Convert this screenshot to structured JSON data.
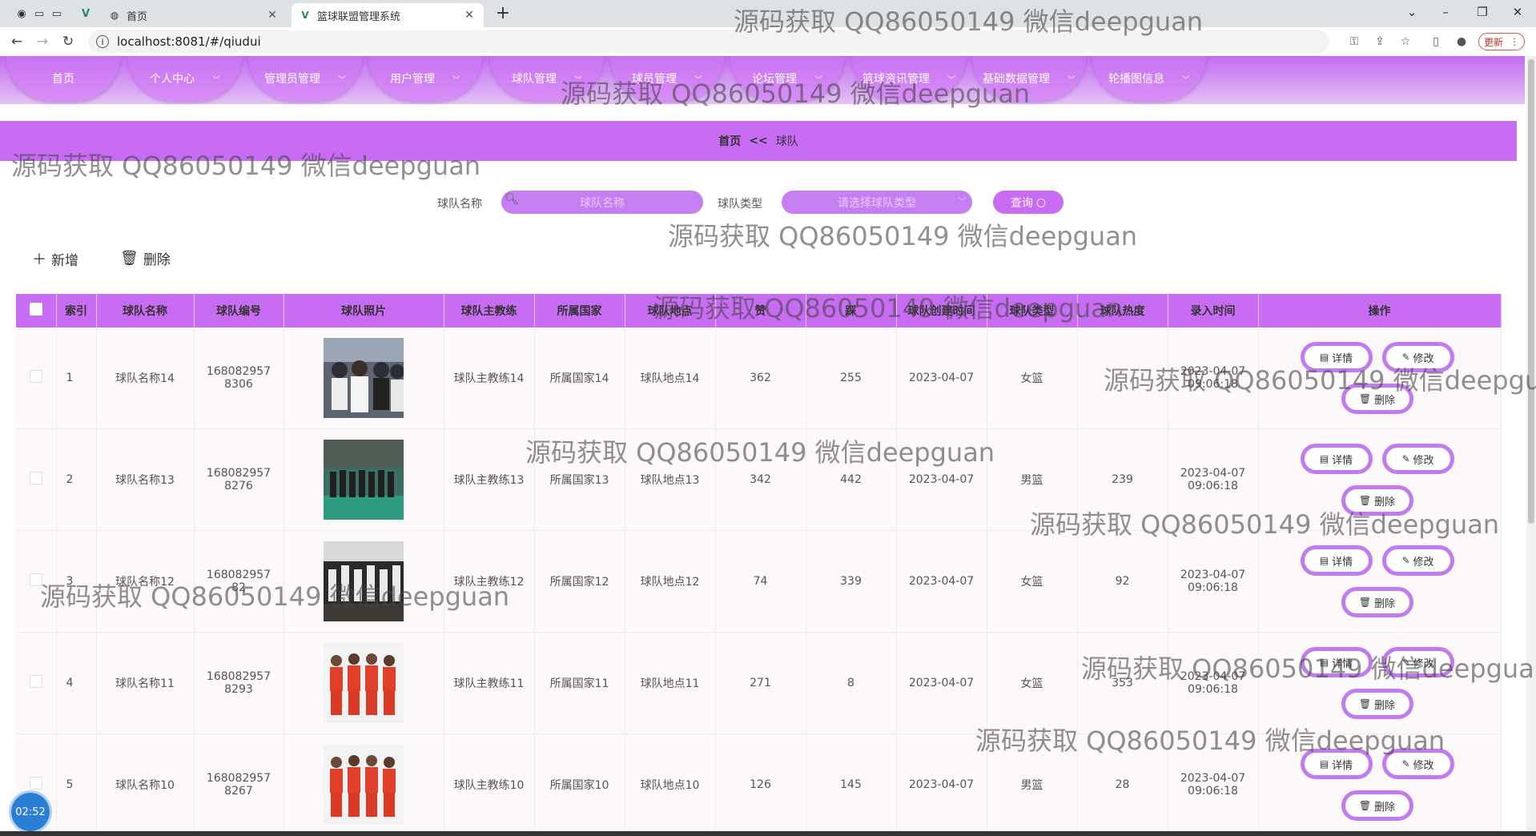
{
  "browser": {
    "tabs": [
      {
        "title": "首页",
        "icon": "globe-icon"
      },
      {
        "title": "篮球联盟管理系统",
        "icon": "vue-logo-icon"
      }
    ],
    "url": "localhost:8081/#/qiudui",
    "update_label": "更新"
  },
  "nav": {
    "items": [
      {
        "label": "首页",
        "dropdown": false
      },
      {
        "label": "个人中心",
        "dropdown": true
      },
      {
        "label": "管理员管理",
        "dropdown": true
      },
      {
        "label": "用户管理",
        "dropdown": true
      },
      {
        "label": "球队管理",
        "dropdown": true
      },
      {
        "label": "球员管理",
        "dropdown": true
      },
      {
        "label": "论坛管理",
        "dropdown": true
      },
      {
        "label": "篮球资讯管理",
        "dropdown": true
      },
      {
        "label": "基础数据管理",
        "dropdown": true
      },
      {
        "label": "轮播图信息",
        "dropdown": true
      }
    ]
  },
  "breadcrumb": {
    "home": "首页",
    "sep": "<<",
    "current": "球队"
  },
  "search": {
    "name_label": "球队名称",
    "name_placeholder": "球队名称",
    "type_label": "球队类型",
    "type_placeholder": "请选择球队类型",
    "query_label": "查询"
  },
  "actions": {
    "add_label": "新增",
    "delete_label": "删除"
  },
  "table": {
    "headers": [
      "索引",
      "球队名称",
      "球队编号",
      "球队照片",
      "球队主教练",
      "所属国家",
      "球队地点",
      "赞",
      "踩",
      "球队创建时间",
      "球队类型",
      "球队热度",
      "录入时间",
      "操作"
    ],
    "rows": [
      {
        "index": "1",
        "name": "球队名称14",
        "code": "1680829578306",
        "coach": "球队主教练14",
        "country": "所属国家14",
        "place": "球队地点14",
        "likes": "362",
        "dislikes": "255",
        "created": "2023-04-07",
        "type": "女篮",
        "heat": "",
        "entered": "2023-04-07 09:06:18"
      },
      {
        "index": "2",
        "name": "球队名称13",
        "code": "1680829578276",
        "coach": "球队主教练13",
        "country": "所属国家13",
        "place": "球队地点13",
        "likes": "342",
        "dislikes": "442",
        "created": "2023-04-07",
        "type": "男篮",
        "heat": "239",
        "entered": "2023-04-07 09:06:18"
      },
      {
        "index": "3",
        "name": "球队名称12",
        "code": "16808295782",
        "coach": "球队主教练12",
        "country": "所属国家12",
        "place": "球队地点12",
        "likes": "74",
        "dislikes": "339",
        "created": "2023-04-07",
        "type": "女篮",
        "heat": "92",
        "entered": "2023-04-07 09:06:18"
      },
      {
        "index": "4",
        "name": "球队名称11",
        "code": "1680829578293",
        "coach": "球队主教练11",
        "country": "所属国家11",
        "place": "球队地点11",
        "likes": "271",
        "dislikes": "8",
        "created": "2023-04-07",
        "type": "女篮",
        "heat": "353",
        "entered": "2023-04-07 09:06:18"
      },
      {
        "index": "5",
        "name": "球队名称10",
        "code": "1680829578267",
        "coach": "球队主教练10",
        "country": "所属国家10",
        "place": "球队地点10",
        "likes": "126",
        "dislikes": "145",
        "created": "2023-04-07",
        "type": "男篮",
        "heat": "28",
        "entered": "2023-04-07 09:06:18"
      }
    ],
    "op_labels": {
      "detail": "详情",
      "edit": "修改",
      "delete": "删除"
    }
  },
  "watermark_text": "源码获取 QQ86050149 微信deepguan",
  "timer": "02:52",
  "colors": {
    "accent": "#c76cf3",
    "button_border": "#c27af1"
  }
}
